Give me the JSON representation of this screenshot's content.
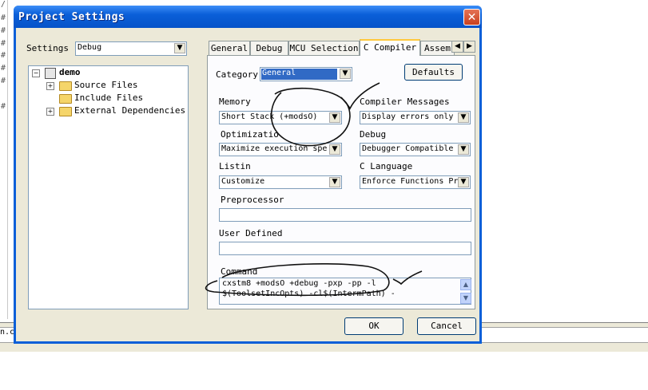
{
  "background": {
    "gutter_marks": [
      "/",
      "#",
      "#",
      "#",
      "#",
      "#",
      "#",
      "#"
    ],
    "output_text": "n.c"
  },
  "dialog": {
    "title": "Project Settings",
    "close_glyph": "✕",
    "settings_label": "Settings",
    "settings_value": "Debug",
    "tree": {
      "root": "demo",
      "items": [
        "Source Files",
        "Include Files",
        "External Dependencies"
      ]
    },
    "tabs": [
      "General",
      "Debug",
      "MCU Selection",
      "C Compiler",
      "Assem"
    ],
    "active_tab": "C Compiler",
    "category_label": "Category",
    "category_value": "General",
    "defaults_button": "Defaults",
    "memory_label": "Memory",
    "memory_value": "Short Stack (+modsO)",
    "compiler_messages_label": "Compiler Messages",
    "compiler_messages_value": "Display errors only",
    "optimization_label": "Optimizatio",
    "optimization_value": "Maximize execution spe",
    "debug_label": "Debug",
    "debug_value": "Debugger Compatible",
    "listing_label": "Listin",
    "listing_value": "Customize",
    "c_language_label": "C Language",
    "c_language_value": "Enforce Functions Pr",
    "preprocessor_label": "Preprocessor",
    "preprocessor_value": "",
    "user_defined_label": "User Defined",
    "user_defined_value": "",
    "command_label": "Command",
    "command_line1": "cxstm8 +modsO +debug -pxp -pp -l",
    "command_line2": "$(ToolsetIncOpts) -cl$(IntermPath) -",
    "ok_button": "OK",
    "cancel_button": "Cancel"
  },
  "colors": {
    "titlebar": "#0a5fd8",
    "dialog_face": "#ece9d8",
    "annotation_ink": "#111111"
  },
  "icons": {
    "close": "close-icon",
    "expand": "expand-plus-icon",
    "collapse": "collapse-minus-icon",
    "folder": "folder-icon",
    "project": "project-icon",
    "dropdown": "chevron-down-icon",
    "tab_scroll_left": "arrow-left-icon",
    "tab_scroll_right": "arrow-right-icon",
    "scroll_up": "scroll-up-icon",
    "scroll_down": "scroll-down-icon"
  }
}
